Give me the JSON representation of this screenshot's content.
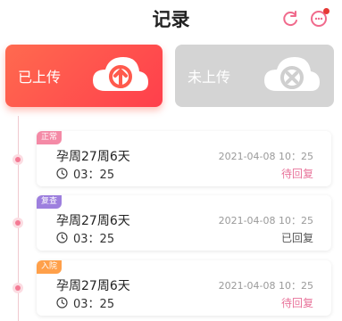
{
  "header": {
    "title": "记录",
    "refresh_icon": "refresh-icon",
    "chat_icon": "chat-icon"
  },
  "summary": {
    "uploaded_label": "已上传",
    "not_uploaded_label": "未上传"
  },
  "records": [
    {
      "tag": "正常",
      "title": "孕周27周6天",
      "time": "03：25",
      "date": "2021-04-08 10：25",
      "status": "待回复"
    },
    {
      "tag": "复查",
      "title": "孕周27周6天",
      "time": "03：25",
      "date": "2021-04-08 10：25",
      "status": "已回复"
    },
    {
      "tag": "入院",
      "title": "孕周27周6天",
      "time": "03：25",
      "date": "2021-04-08 10：25",
      "status": "待回复"
    }
  ],
  "colors": {
    "accent": "#ff4f4c",
    "pending_status": "#e8739a",
    "replied_status": "#555555"
  }
}
